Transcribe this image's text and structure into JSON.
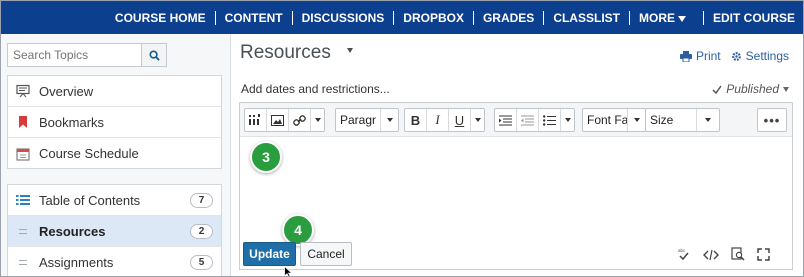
{
  "topnav": {
    "items": [
      "COURSE HOME",
      "CONTENT",
      "DISCUSSIONS",
      "DROPBOX",
      "GRADES",
      "CLASSLIST",
      "MORE",
      "EDIT COURSE"
    ]
  },
  "sidebar": {
    "search_placeholder": "Search Topics",
    "top_items": [
      {
        "label": "Overview",
        "icon": "overview-icon"
      },
      {
        "label": "Bookmarks",
        "icon": "bookmark-icon"
      },
      {
        "label": "Course Schedule",
        "icon": "calendar-icon"
      }
    ],
    "bottom_items": [
      {
        "label": "Table of Contents",
        "badge": "7",
        "icon": "list-icon"
      },
      {
        "label": "Resources",
        "badge": "2",
        "icon": "drag-handle-icon",
        "selected": true
      },
      {
        "label": "Assignments",
        "badge": "5",
        "icon": "drag-handle-icon"
      }
    ]
  },
  "main": {
    "title": "Resources",
    "print_label": "Print",
    "settings_label": "Settings",
    "restrictions_label": "Add dates and restrictions...",
    "published_label": "Published"
  },
  "editor": {
    "paragraph_value": "Paragr",
    "font_family_value": "Font Fa",
    "size_value": "Size",
    "more_label": "•••"
  },
  "buttons": {
    "update_label": "Update",
    "cancel_label": "Cancel"
  },
  "steps": [
    "3",
    "4"
  ],
  "colors": {
    "nav_bg": "#0d3f8f",
    "step_green": "#2a9d3f",
    "primary_button": "#1e6fa8"
  }
}
